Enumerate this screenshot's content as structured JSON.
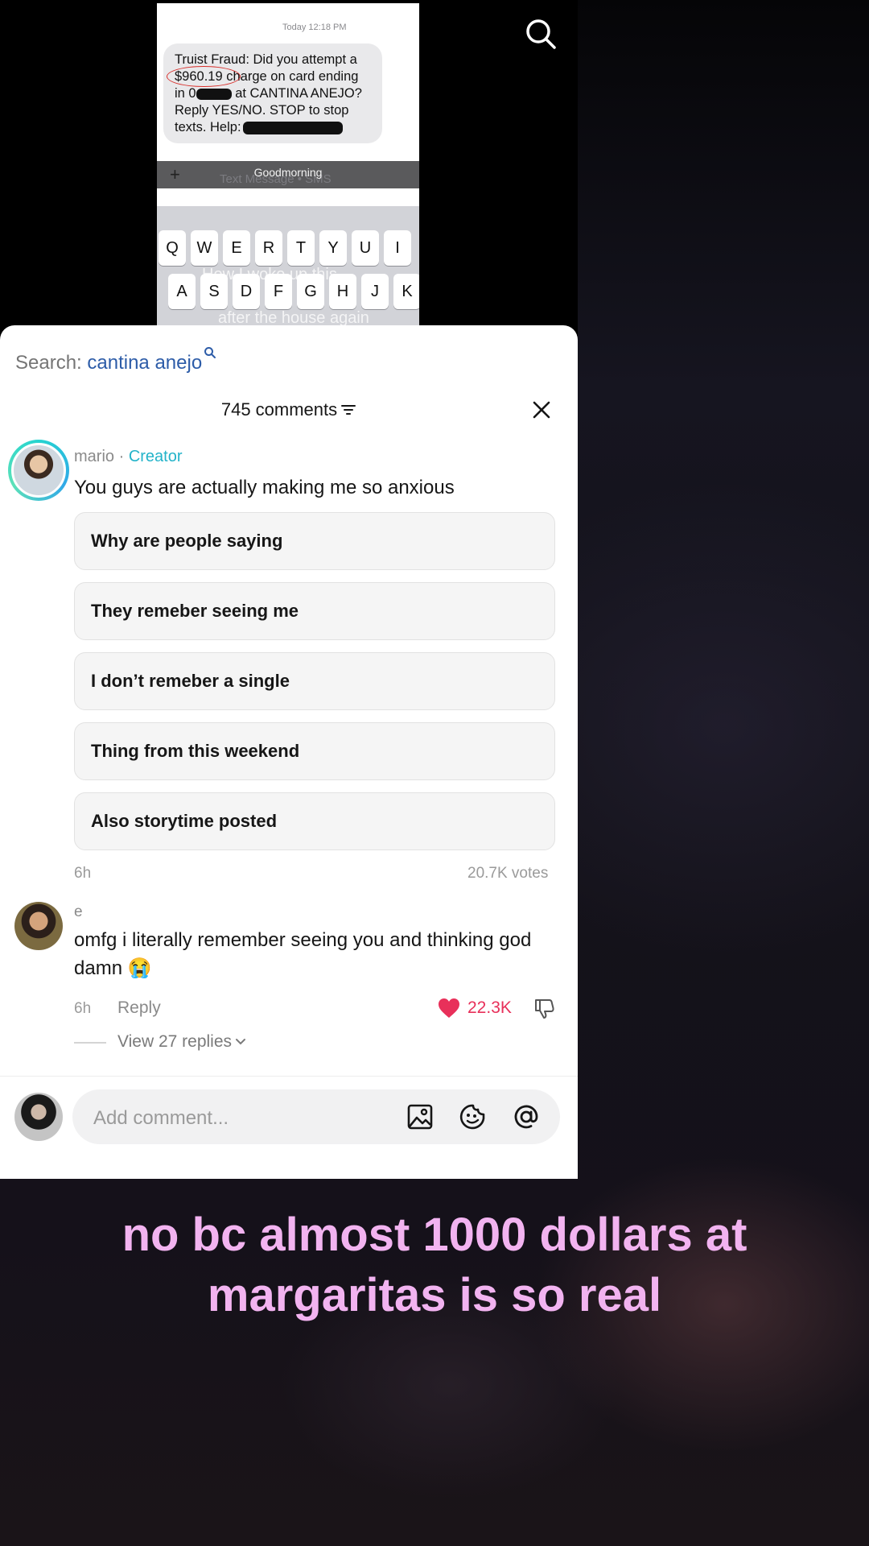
{
  "phone": {
    "time": "Today 12:18 PM",
    "sms_lines": [
      "Truist Fraud: Did you attempt a",
      "$960.19 charge on card ending",
      "in 0",
      "at CANTINA ANEJO?",
      "Reply YES/NO. STOP to stop",
      "texts. Help:"
    ],
    "toolbar_overlay": "Goodmorning",
    "input_placeholder": "Text Message • SMS",
    "keyboard_row1": [
      "Q",
      "W",
      "E",
      "R",
      "T",
      "Y",
      "U",
      "I"
    ],
    "keyboard_row2": [
      "A",
      "S",
      "D",
      "F",
      "G",
      "H",
      "J",
      "K"
    ],
    "overlay_text_1": "How I woke up this",
    "overlay_text_2": "after the house again"
  },
  "comments": {
    "search_label": "Search:",
    "search_term": "cantina anejo",
    "count_label": "745 comments",
    "creator": {
      "name": "mario",
      "separator": "·",
      "tag": "Creator",
      "text": "You guys are actually making me so anxious",
      "poll_options": [
        "Why are people saying",
        "They remeber seeing me",
        "I don’t remeber a single",
        "Thing from this weekend",
        "Also storytime posted"
      ],
      "time": "6h",
      "votes": "20.7K votes"
    },
    "reply_comment": {
      "name": "e",
      "text": "omfg i literally remember seeing you and thinking god damn 😭",
      "time": "6h",
      "reply_label": "Reply",
      "likes": "22.3K",
      "view_replies": "View 27 replies"
    },
    "add_comment_placeholder": "Add comment..."
  },
  "caption": "no bc almost 1000 dollars at margaritas is so real",
  "colors": {
    "creator_tag": "#23b3c9",
    "search_term": "#2d5ca8",
    "like_heart": "#e8305a",
    "caption": "#f2b3f0"
  }
}
